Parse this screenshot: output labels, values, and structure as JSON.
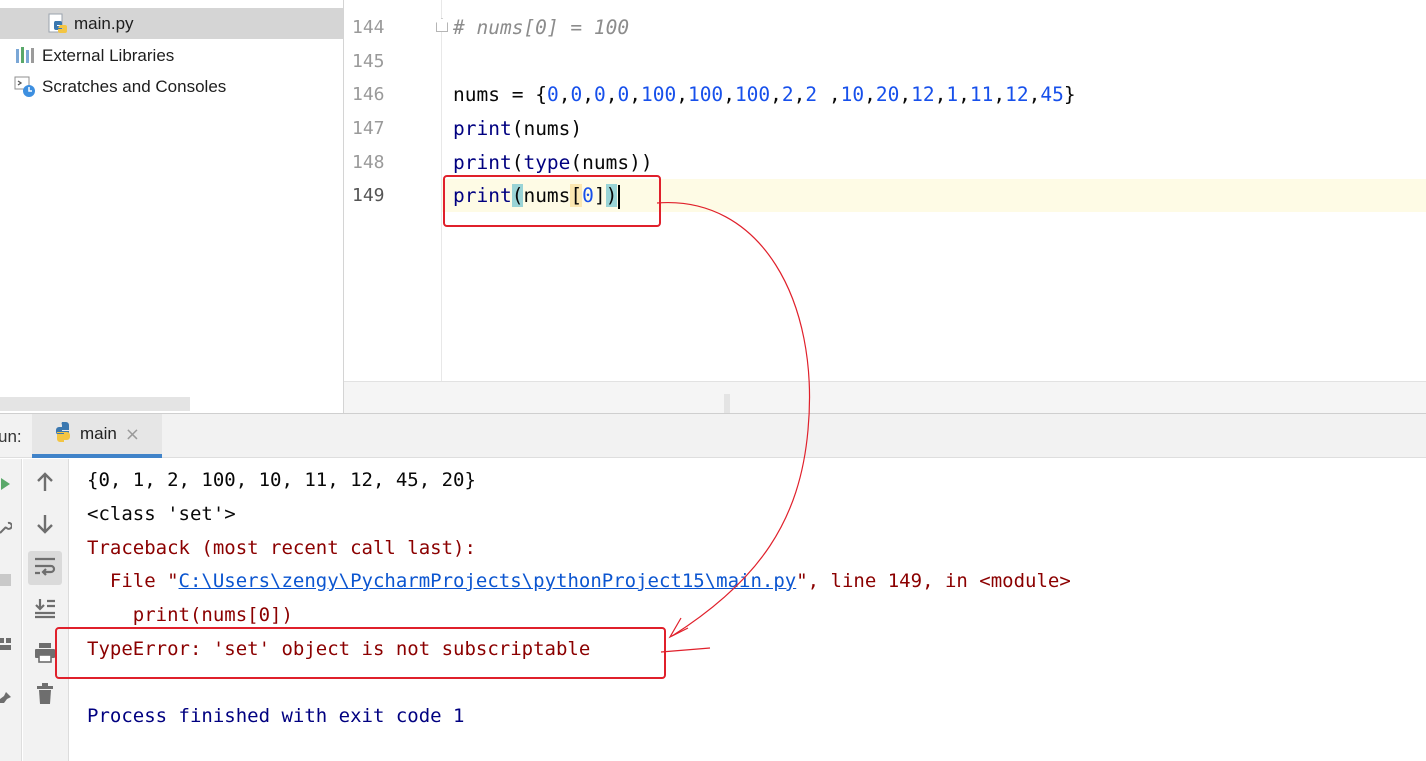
{
  "project_tree": {
    "items": [
      {
        "label": "main.py",
        "icon": "python-file-icon"
      },
      {
        "label": "External Libraries",
        "icon": "libraries-icon"
      },
      {
        "label": "Scratches and Consoles",
        "icon": "scratches-icon"
      }
    ]
  },
  "editor": {
    "lines": [
      {
        "number": "144",
        "text": "# nums[0] = 100"
      },
      {
        "number": "145",
        "text": ""
      },
      {
        "number": "146",
        "text": "nums = {0,0,0,0,100,100,100,2,2 ,10,20,12,1,11,12,45}"
      },
      {
        "number": "147",
        "text": "print(nums)"
      },
      {
        "number": "148",
        "text": "print(type(nums))"
      },
      {
        "number": "149",
        "text": "print(nums[0])"
      }
    ],
    "current_line": "149",
    "current_line_color": "#fefbe5"
  },
  "run_panel": {
    "label": "un:",
    "tab_label": "main",
    "tab_close": "×",
    "output": [
      "{0, 1, 2, 100, 10, 11, 12, 45, 20}",
      "<class 'set'>",
      "Traceback (most recent call last):",
      "  File \"",
      "C:\\Users\\zengy\\PycharmProjects\\pythonProject15\\main.py",
      "\", line 149, in <module>",
      "    print(nums[0])",
      "TypeError: 'set' object is not subscriptable",
      "Process finished with exit code 1"
    ],
    "toolbar": [
      "arrow-up-icon",
      "arrow-down-icon",
      "soft-wrap-icon",
      "scroll-to-end-icon",
      "print-icon",
      "trash-icon"
    ]
  },
  "colors": {
    "error_text": "#8b0000",
    "link": "#0b55d0",
    "annotation_red": "#e0202b",
    "number_literal": "#1750eb",
    "builtin": "#000080"
  }
}
